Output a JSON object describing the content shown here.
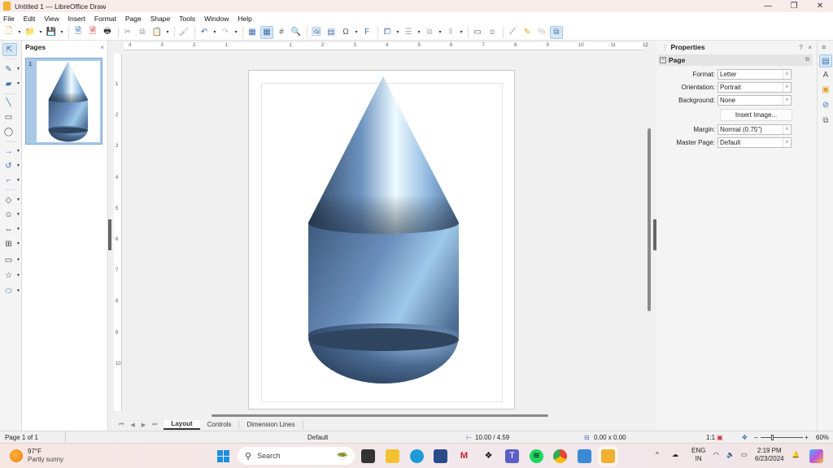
{
  "window": {
    "title": "Untitled 1 — LibreOffice Draw",
    "minimize": "—",
    "maximize": "❐",
    "close": "✕"
  },
  "menu": [
    "File",
    "Edit",
    "View",
    "Insert",
    "Format",
    "Page",
    "Shape",
    "Tools",
    "Window",
    "Help"
  ],
  "menu_close": "×",
  "toolbar_icons": [
    "new-icon",
    "open-icon",
    "save-icon",
    "export-icon",
    "export-pdf-icon",
    "print-icon",
    "cut-icon",
    "copy-icon",
    "paste-icon",
    "clone-formatting-icon",
    "undo-icon",
    "redo-icon",
    "grid-icon",
    "helplines-icon",
    "snap-icon",
    "zoom-pan-icon",
    "image-icon",
    "textbox-icon",
    "special-character-icon",
    "fontwork-icon",
    "transformations-icon",
    "align-icon",
    "arrange-icon",
    "distribute-icon",
    "shadow-icon",
    "crop-icon",
    "points-icon",
    "glue-points-icon",
    "toggle-extrusion-icon",
    "3d-effects-icon"
  ],
  "pages_panel": {
    "title": "Pages",
    "close": "×",
    "pages": [
      {
        "number": "1"
      }
    ]
  },
  "rulers": {
    "horizontal": [
      "4",
      "3",
      "2",
      "1",
      "",
      "1",
      "2",
      "3",
      "4",
      "5",
      "6",
      "7",
      "8",
      "9",
      "10",
      "11",
      "12"
    ],
    "vertical": [
      "1",
      "2",
      "3",
      "4",
      "5",
      "6",
      "7",
      "8",
      "9",
      "10"
    ]
  },
  "tabs": {
    "nav": [
      "⏮",
      "◀",
      "▶",
      "⏭"
    ],
    "items": [
      {
        "label": "Layout",
        "active": true
      },
      {
        "label": "Controls"
      },
      {
        "label": "Dimension Lines"
      }
    ]
  },
  "sidebar": {
    "title": "Properties",
    "help": "?",
    "close": "×",
    "menu": "≡",
    "section": "Page",
    "fields": [
      {
        "label": "Format:",
        "value": "Letter"
      },
      {
        "label": "Orientation:",
        "value": "Portrait"
      },
      {
        "label": "Background:",
        "value": "None"
      },
      {
        "label": "Margin:",
        "value": "Normal (0.75\")"
      },
      {
        "label": "Master Page:",
        "value": "Default"
      }
    ],
    "insert_image": "Insert Image...",
    "deck_icons": [
      "properties-icon",
      "styles-icon",
      "gallery-icon",
      "navigator-icon",
      "shapes-icon"
    ]
  },
  "status": {
    "page": "Page 1 of 1",
    "layout": "Default",
    "position": "10.00 / 4.59",
    "size": "0.00 x 0.00",
    "scale": "1:1",
    "zoom": "60%",
    "zoom_minus": "−",
    "zoom_plus": "+"
  },
  "taskbar": {
    "weather_temp": "97°F",
    "weather_desc": "Partly sunny",
    "search_placeholder": "Search",
    "language": "ENG",
    "region": "IN",
    "time": "2:19 PM",
    "date": "6/23/2024"
  },
  "colors": {
    "accent": "#3a6fb0",
    "shape_base": "#5a80ad",
    "shape_dark": "#2e4560",
    "shape_light": "#e8f6ff"
  }
}
